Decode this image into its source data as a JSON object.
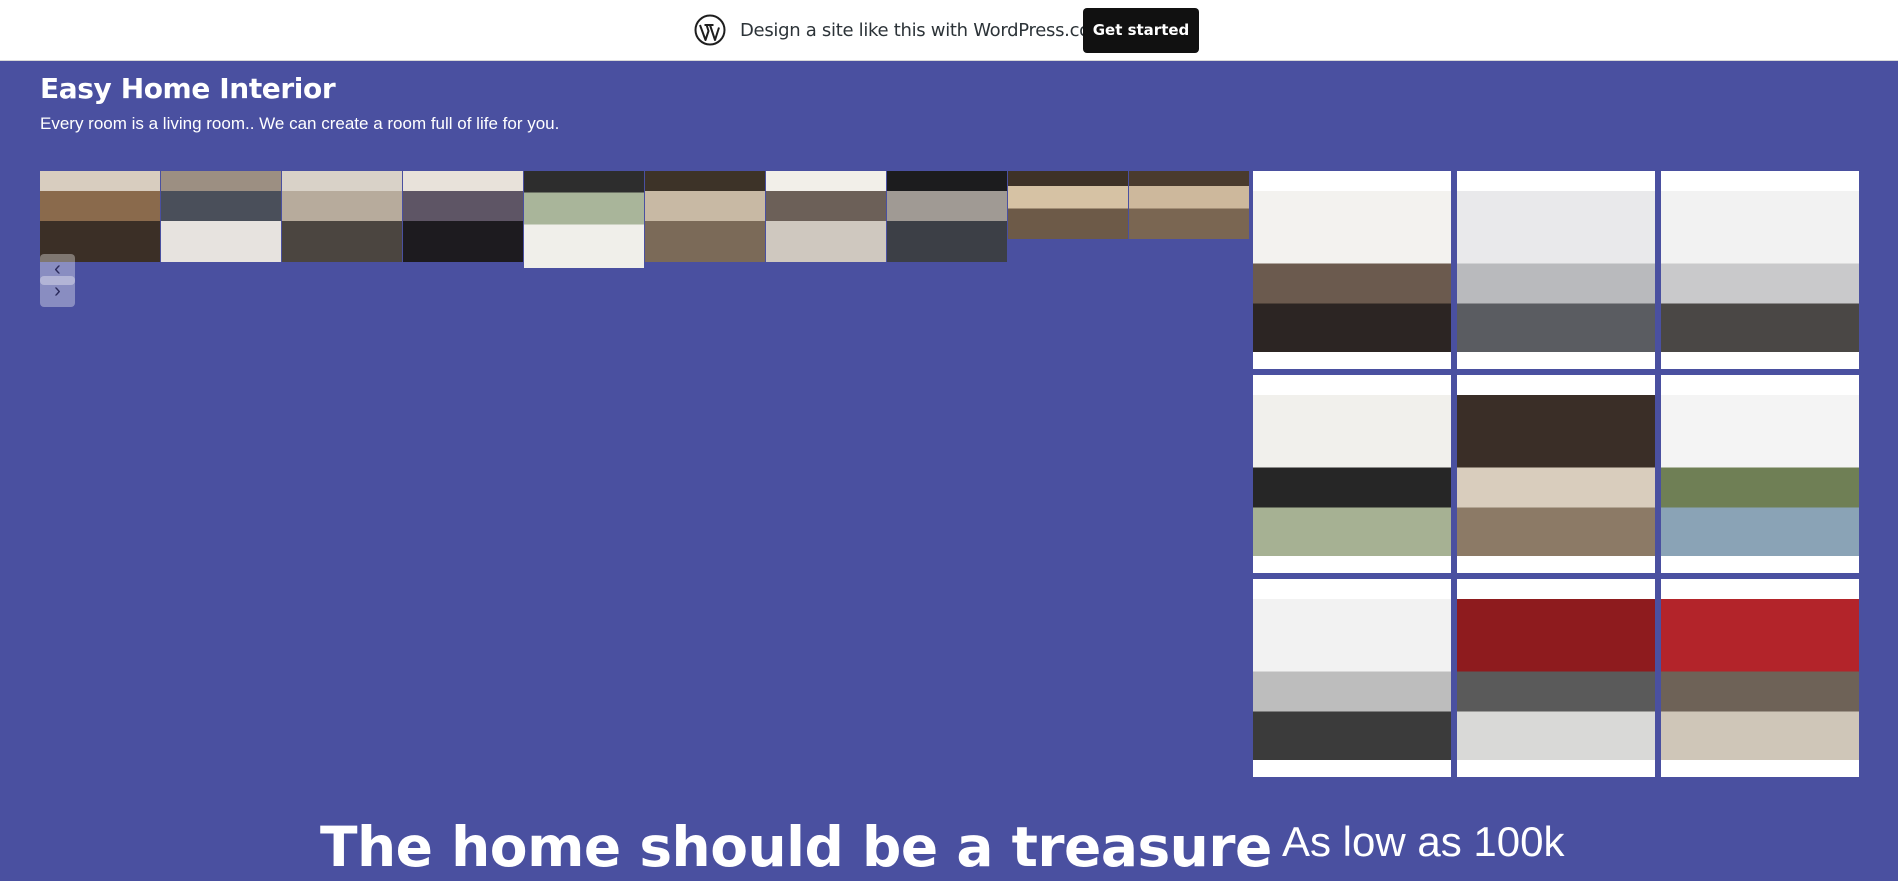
{
  "wp_banner": {
    "logo_icon": "wordpress-logo-icon",
    "text": "Design a site like this with WordPress.com",
    "button_label": "Get started"
  },
  "site": {
    "title": "Easy Home Interior",
    "tagline": "Every room is a living room.. We can create a room full of life for you."
  },
  "slideshow": {
    "prev_icon": "chevron-left-icon",
    "next_icon": "chevron-right-icon",
    "prev_glyph": "‹",
    "next_glyph": "›",
    "thumbnails": [
      {
        "name": "bedroom-wood-panel",
        "colors": [
          "#3b2f26",
          "#8a6a4c",
          "#d8cdbf"
        ]
      },
      {
        "name": "living-tv-wall",
        "colors": [
          "#e7e3df",
          "#4a4f5a",
          "#9c8f82"
        ]
      },
      {
        "name": "lounge-sofa",
        "colors": [
          "#4b4540",
          "#b7ab9c",
          "#d9d2c8"
        ]
      },
      {
        "name": "bedroom-dark-headboard",
        "colors": [
          "#1d1b1f",
          "#5e5565",
          "#e8e2da"
        ]
      },
      {
        "name": "study-shelf",
        "colors": [
          "#f0efea",
          "#a9b59a",
          "#2d2d2d"
        ]
      },
      {
        "name": "room-plants",
        "colors": [
          "#7b6a58",
          "#c8b9a4",
          "#3d3328"
        ]
      },
      {
        "name": "living-white-sofa",
        "colors": [
          "#cfc8bf",
          "#6c6058",
          "#f2efe9"
        ]
      },
      {
        "name": "staircase-hall",
        "colors": [
          "#3c3f46",
          "#a09a94",
          "#1c1c1e"
        ]
      },
      {
        "name": "bedroom-chandelier",
        "colors": [
          "#6d5a48",
          "#d6c2a4",
          "#3e3227"
        ]
      },
      {
        "name": "bedroom-chandelier-2",
        "colors": [
          "#7a6652",
          "#cdb89c",
          "#4a3b2e"
        ]
      }
    ]
  },
  "gallery": {
    "tiles": [
      {
        "name": "dining-tv",
        "colors": [
          "#f3f2ef",
          "#2c2523",
          "#6b5a4e"
        ]
      },
      {
        "name": "kitchen-fridge",
        "colors": [
          "#e9e9eb",
          "#5a5c61",
          "#b9babd"
        ]
      },
      {
        "name": "laundry-kitchen",
        "colors": [
          "#f2f2f2",
          "#4a4745",
          "#c9c9cb"
        ]
      },
      {
        "name": "study-shelf-large",
        "colors": [
          "#f1f0ec",
          "#a6b193",
          "#262626"
        ]
      },
      {
        "name": "living-dark",
        "colors": [
          "#3a2e27",
          "#8c7a66",
          "#d9cdbd"
        ]
      },
      {
        "name": "kitchen-window",
        "colors": [
          "#f4f4f4",
          "#8aa3b6",
          "#6f7f55"
        ]
      },
      {
        "name": "stove",
        "colors": [
          "#f2f2f2",
          "#3b3b3b",
          "#bdbdbd"
        ]
      },
      {
        "name": "kitchen-red",
        "colors": [
          "#8e1b1e",
          "#d9d9d7",
          "#5a5a5a"
        ]
      },
      {
        "name": "kitchen-red-tiles",
        "colors": [
          "#b3242a",
          "#cfc6b8",
          "#6e6257"
        ]
      }
    ]
  },
  "content": {
    "headline": "The home should be a treasure",
    "price": "As low as 100k"
  }
}
